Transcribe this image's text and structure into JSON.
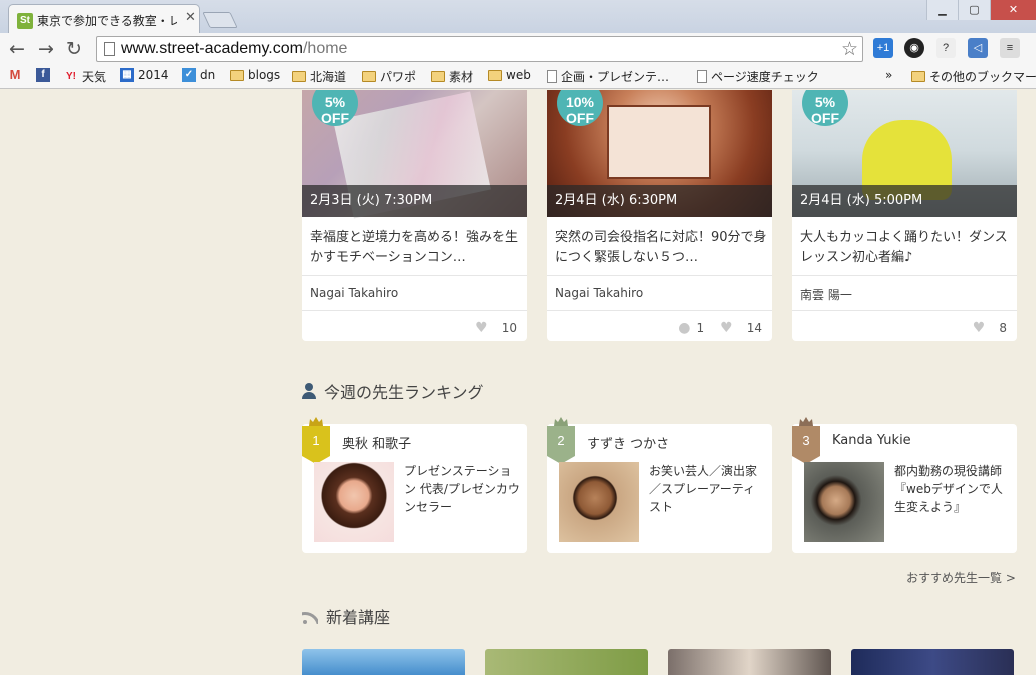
{
  "browser": {
    "tab_title": "東京で参加できる教室・レ",
    "favicon_text": "St",
    "url_host": "www.street-academy.com",
    "url_path": "/home",
    "bookmarks": [
      {
        "label": "M",
        "kind": "gmail-icon"
      },
      {
        "label": "f",
        "kind": "facebook-icon"
      },
      {
        "label": "天気",
        "kind": "yahoo-icon"
      },
      {
        "label": "2014",
        "kind": "calendar-icon"
      },
      {
        "label": "dn",
        "kind": "app-icon"
      },
      {
        "label": "blogs",
        "kind": "folder-icon"
      },
      {
        "label": "北海道",
        "kind": "folder-icon"
      },
      {
        "label": "パワポ",
        "kind": "folder-icon"
      },
      {
        "label": "素材",
        "kind": "folder-icon"
      },
      {
        "label": "web",
        "kind": "folder-icon"
      },
      {
        "label": "企画・プレゼンテ…",
        "kind": "page-icon"
      },
      {
        "label": "ページ速度チェック",
        "kind": "page-icon"
      }
    ],
    "bookmarks_overflow": "»",
    "other_bookmarks": "その他のブックマーク"
  },
  "classes": [
    {
      "discount": "5%\nOFF",
      "date": "2月3日 (火) 7:30PM",
      "title": "幸福度と逆境力を高める！強みを生かすモチベーションコン…",
      "teacher": "Nagai Takahiro",
      "comments": "",
      "likes": "10"
    },
    {
      "discount": "10%\nOFF",
      "date": "2月4日 (水) 6:30PM",
      "title": "突然の司会役指名に対応！90分で身につく緊張しない５つ…",
      "teacher": "Nagai Takahiro",
      "comments": "1",
      "likes": "14"
    },
    {
      "discount": "5%\nOFF",
      "date": "2月4日 (水) 5:00PM",
      "title": "大人もカッコよく踊りたい！ダンスレッスン初心者編♪",
      "teacher": "南雲 陽一",
      "comments": "",
      "likes": "8"
    }
  ],
  "ranking": {
    "heading": "今週の先生ランキング",
    "items": [
      {
        "rank": "1",
        "name": "奥秋 和歌子",
        "desc": "プレゼンステーション 代表/プレゼンカウンセラー",
        "color": "#d9c21c"
      },
      {
        "rank": "2",
        "name": "すずき つかさ",
        "desc": "お笑い芸人／演出家／スプレーアーティスト",
        "color": "#9bb28a"
      },
      {
        "rank": "3",
        "name": "Kanda Yukie",
        "desc": "都内勤務の現役講師『webデザインで人生変えよう』",
        "color": "#b08a67"
      }
    ],
    "more_link": "おすすめ先生一覧 >"
  },
  "new_courses": {
    "heading": "新着講座"
  }
}
